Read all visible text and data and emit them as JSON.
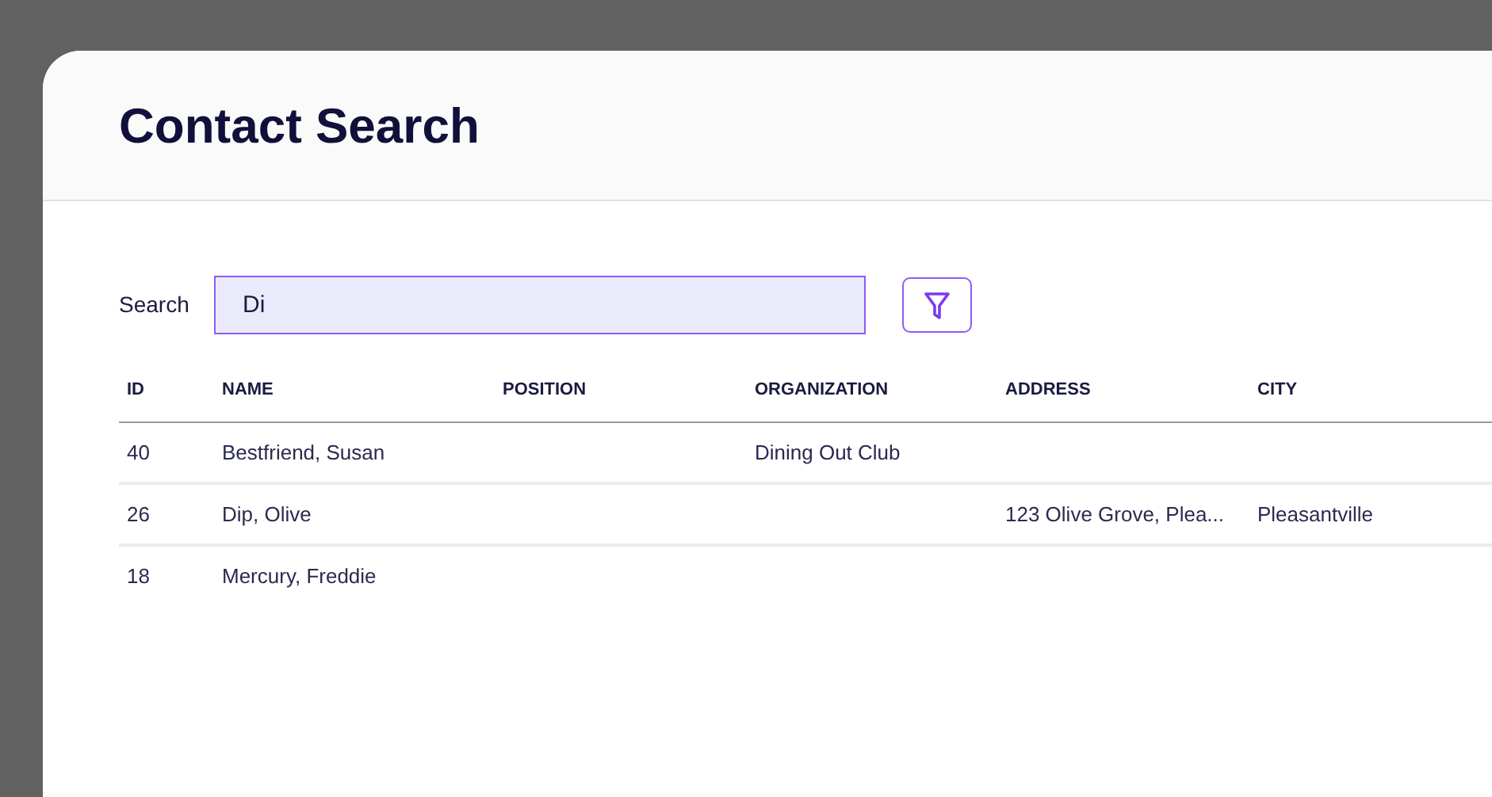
{
  "title": "Contact Search",
  "search": {
    "label": "Search",
    "value": "Di"
  },
  "table": {
    "columns": [
      "ID",
      "NAME",
      "POSITION",
      "ORGANIZATION",
      "ADDRESS",
      "CITY"
    ],
    "rows": [
      {
        "id": "40",
        "name": "Bestfriend, Susan",
        "organization": "Dining Out Club"
      },
      {
        "id": "26",
        "name": "Dip, Olive",
        "address": "123 Olive Grove, Plea...",
        "city": "Pleasantville"
      },
      {
        "id": "18",
        "name": "Mercury, Freddie"
      }
    ]
  }
}
